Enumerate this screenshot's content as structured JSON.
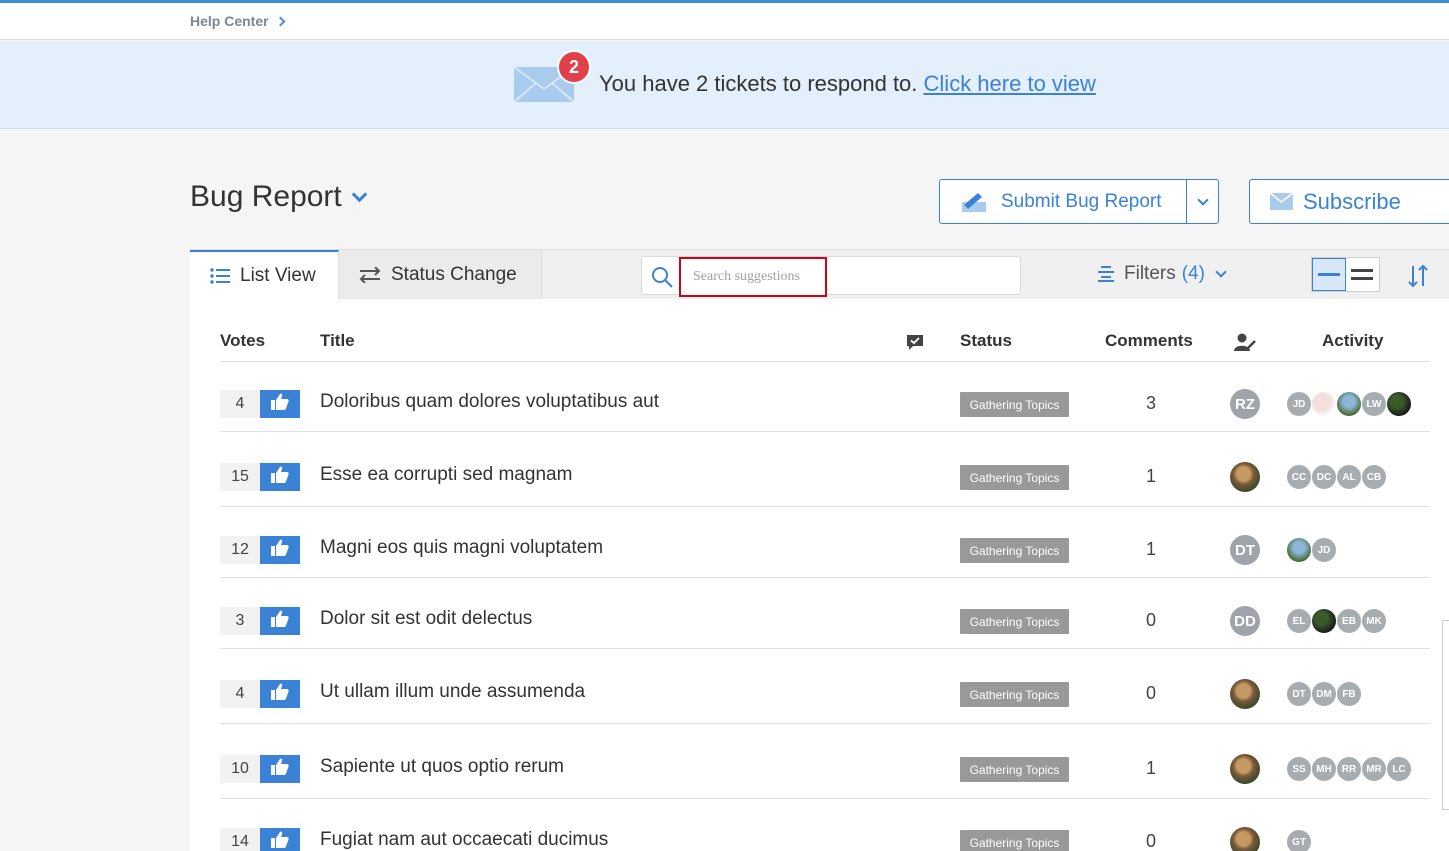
{
  "header": {
    "breadcrumb": "Help Center"
  },
  "banner": {
    "badge_count": "2",
    "message": "You have 2 tickets to respond to.",
    "link": "Click here to view"
  },
  "board": {
    "title": "Bug Report"
  },
  "actions": {
    "submit_label": "Submit Bug Report",
    "subscribe_label": "Subscribe"
  },
  "toolbar": {
    "tab_list": "List View",
    "tab_status": "Status Change",
    "search_placeholder": "Search suggestions",
    "filters_label": "Filters",
    "filters_count": "(4)"
  },
  "columns": {
    "votes": "Votes",
    "title": "Title",
    "status": "Status",
    "comments": "Comments",
    "activity": "Activity"
  },
  "rows": [
    {
      "votes": "4",
      "title": "Doloribus quam dolores voluptatibus aut",
      "status": "Gathering Topics",
      "comments": "3",
      "owner": "RZ",
      "activity": [
        "JD",
        "",
        "",
        "LW",
        ""
      ]
    },
    {
      "votes": "15",
      "title": "Esse ea corrupti sed magnam",
      "status": "Gathering Topics",
      "comments": "1",
      "owner": "",
      "activity": [
        "CC",
        "DC",
        "AL",
        "CB"
      ]
    },
    {
      "votes": "12",
      "title": "Magni eos quis magni voluptatem",
      "status": "Gathering Topics",
      "comments": "1",
      "owner": "DT",
      "activity": [
        "",
        "JD"
      ]
    },
    {
      "votes": "3",
      "title": "Dolor sit est odit delectus",
      "status": "Gathering Topics",
      "comments": "0",
      "owner": "DD",
      "activity": [
        "EL",
        "",
        "EB",
        "MK"
      ]
    },
    {
      "votes": "4",
      "title": "Ut ullam illum unde assumenda",
      "status": "Gathering Topics",
      "comments": "0",
      "owner": "",
      "activity": [
        "DT",
        "DM",
        "FB"
      ]
    },
    {
      "votes": "10",
      "title": "Sapiente ut quos optio rerum",
      "status": "Gathering Topics",
      "comments": "1",
      "owner": "",
      "activity": [
        "SS",
        "MH",
        "RR",
        "MR",
        "LC"
      ]
    },
    {
      "votes": "14",
      "title": "Fugiat nam aut occaecati ducimus",
      "status": "Gathering Topics",
      "comments": "0",
      "owner": "",
      "activity": [
        "GT"
      ]
    }
  ]
}
